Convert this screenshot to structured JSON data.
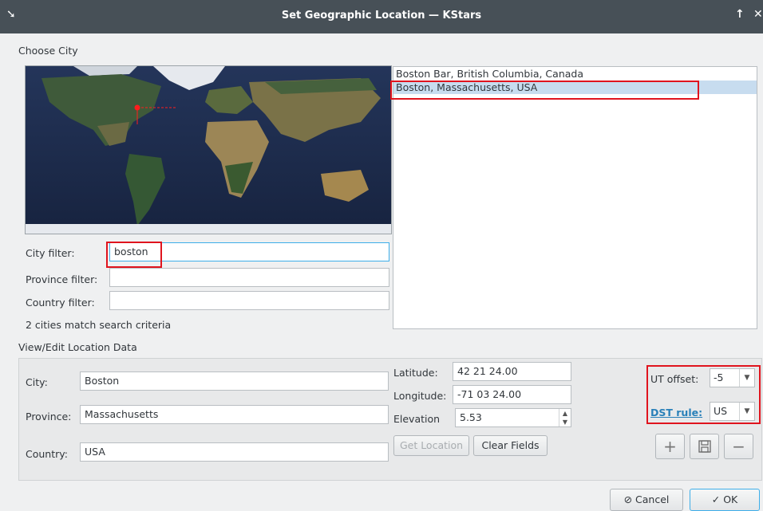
{
  "window": {
    "title": "Set Geographic Location — KStars"
  },
  "choose_city": {
    "label": "Choose City",
    "city_filter_label": "City filter:",
    "city_filter_value": "boston",
    "province_filter_label": "Province filter:",
    "province_filter_value": "",
    "country_filter_label": "Country filter:",
    "country_filter_value": "",
    "match_text": "2 cities match search criteria",
    "cities": [
      "Boston Bar, British Columbia, Canada",
      "Boston, Massachusetts, USA"
    ]
  },
  "location_data": {
    "label": "View/Edit Location Data",
    "city_label": "City:",
    "city_value": "Boston",
    "province_label": "Province:",
    "province_value": "Massachusetts",
    "country_label": "Country:",
    "country_value": "USA",
    "latitude_label": "Latitude:",
    "latitude_value": "42 21 24.00",
    "longitude_label": "Longitude:",
    "longitude_value": "-71 03 24.00",
    "elevation_label": "Elevation",
    "elevation_value": "5.53",
    "get_location_label": "Get Location",
    "clear_fields_label": "Clear Fields",
    "ut_offset_label": "UT offset:",
    "ut_offset_value": "-5",
    "dst_rule_label": "DST rule:",
    "dst_rule_value": "US"
  },
  "footer": {
    "cancel_label": "Cancel",
    "ok_label": "OK"
  },
  "colors": {
    "titlebar": "#475057",
    "selection": "#c7dcef",
    "highlight": "#e0141e",
    "link": "#2980b9"
  }
}
